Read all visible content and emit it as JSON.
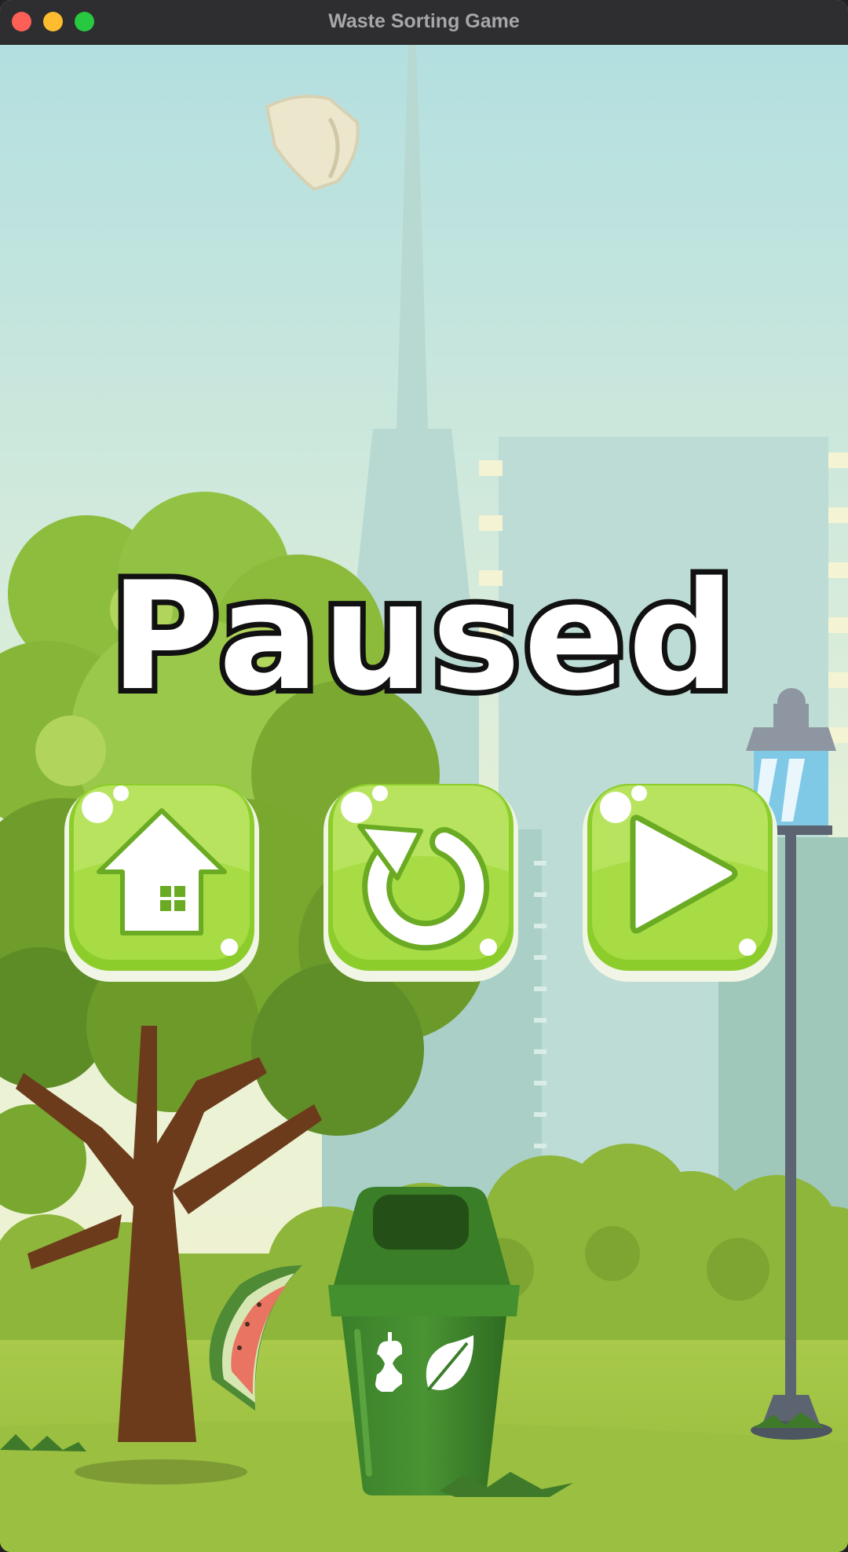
{
  "window": {
    "title": "Waste Sorting Game"
  },
  "pause_menu": {
    "title": "Paused",
    "buttons": [
      {
        "name": "home",
        "icon": "house-icon"
      },
      {
        "name": "restart",
        "icon": "restart-icon"
      },
      {
        "name": "resume",
        "icon": "play-icon"
      }
    ]
  },
  "scene": {
    "falling_item": "crumpled-paper",
    "bin_type": "organic",
    "bin_icons": [
      "apple-core-icon",
      "leaf-icon"
    ],
    "ground_item": "watermelon-rind"
  },
  "colors": {
    "button_green": "#9ed63a",
    "bin_green": "#3d8a2e",
    "sky_top": "#b3dfe0",
    "sky_bottom": "#f3f3cf"
  }
}
